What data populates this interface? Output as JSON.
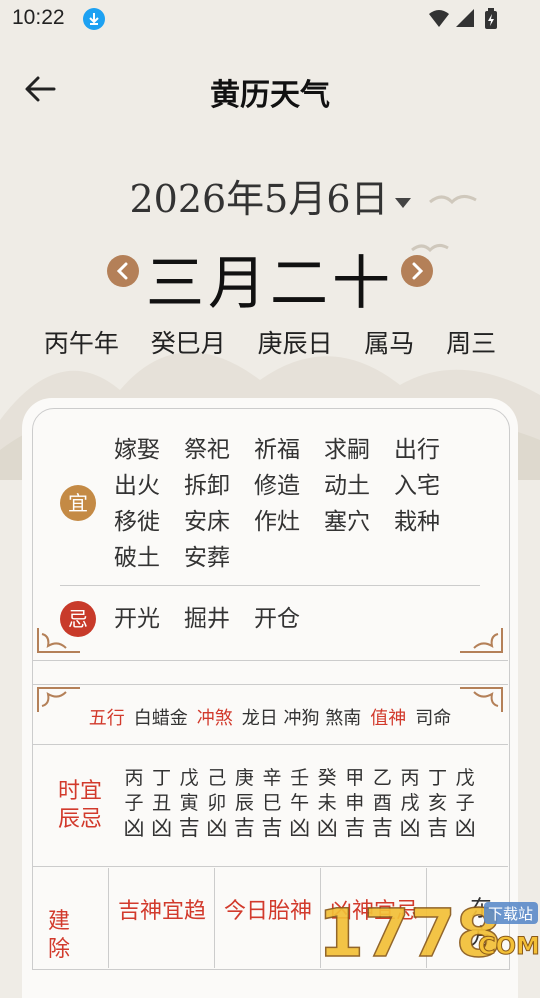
{
  "status": {
    "time": "10:22"
  },
  "appbar": {
    "title": "黄历天气"
  },
  "date": {
    "solar": "2026年5月6日",
    "lunar": "三月二十"
  },
  "ganzhi": [
    "丙午年",
    "癸巳月",
    "庚辰日",
    "属马",
    "周三"
  ],
  "yi": {
    "label": "宜",
    "items": [
      "嫁娶",
      "祭祀",
      "祈福",
      "求嗣",
      "出行",
      "出火",
      "拆卸",
      "修造",
      "动土",
      "入宅",
      "移徙",
      "安床",
      "作灶",
      "塞穴",
      "栽种",
      "破土",
      "安葬"
    ]
  },
  "ji": {
    "label": "忌",
    "items": [
      "开光",
      "掘井",
      "开仓"
    ]
  },
  "wuxing": {
    "wuxing_label": "五行",
    "wuxing_value": "白蜡金",
    "chongsha_label": "冲煞",
    "chongsha_value": "龙日 冲狗 煞南",
    "zhishen_label": "值神",
    "zhishen_value": "司命"
  },
  "hours": {
    "label_line1": "时宜",
    "label_line2": "辰忌",
    "columns": [
      {
        "gan": "丙",
        "zhi": "子",
        "luck": "凶"
      },
      {
        "gan": "丁",
        "zhi": "丑",
        "luck": "凶"
      },
      {
        "gan": "戊",
        "zhi": "寅",
        "luck": "吉"
      },
      {
        "gan": "己",
        "zhi": "卯",
        "luck": "凶"
      },
      {
        "gan": "庚",
        "zhi": "辰",
        "luck": "吉"
      },
      {
        "gan": "辛",
        "zhi": "巳",
        "luck": "吉"
      },
      {
        "gan": "壬",
        "zhi": "午",
        "luck": "凶"
      },
      {
        "gan": "癸",
        "zhi": "未",
        "luck": "凶"
      },
      {
        "gan": "甲",
        "zhi": "申",
        "luck": "吉"
      },
      {
        "gan": "乙",
        "zhi": "酉",
        "luck": "吉"
      },
      {
        "gan": "丙",
        "zhi": "戌",
        "luck": "凶"
      },
      {
        "gan": "丁",
        "zhi": "亥",
        "luck": "吉"
      },
      {
        "gan": "戊",
        "zhi": "子",
        "luck": "凶"
      }
    ]
  },
  "bottom": {
    "jianchu": "建除",
    "jishen": "吉神宜趋",
    "taishen": "今日胎神",
    "xiongshen": "凶神宜忌",
    "direction": "东方"
  },
  "watermark": {
    "text": "1778",
    "sub": "下载站",
    "com": "COM"
  }
}
